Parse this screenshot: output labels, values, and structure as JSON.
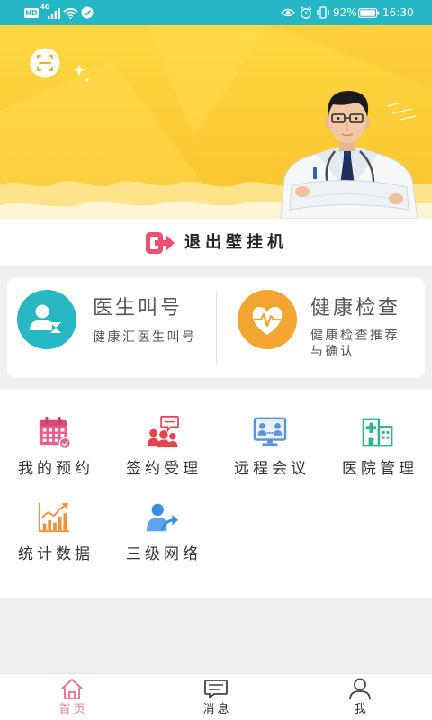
{
  "status_bar": {
    "hd": "HD",
    "network": "4G",
    "battery": "92%",
    "time": "16:30",
    "icons": [
      "signal-icon",
      "wifi-icon",
      "notification-icon",
      "eye-icon",
      "alarm-icon",
      "vibrate-icon",
      "battery-icon"
    ]
  },
  "banner": {
    "scan_icon": "scan-icon",
    "illustration": "doctor-illustration"
  },
  "exit": {
    "label": "退出壁挂机",
    "icon": "exit-icon"
  },
  "features": [
    {
      "title": "医生叫号",
      "subtitle": "健康汇医生叫号",
      "icon": "doctor-call-icon"
    },
    {
      "title": "健康检查",
      "subtitle": "健康检查推荐与确认",
      "icon": "health-check-heart-icon"
    }
  ],
  "grid": [
    {
      "label": "我的预约",
      "icon": "calendar-icon"
    },
    {
      "label": "签约受理",
      "icon": "contract-group-icon"
    },
    {
      "label": "远程会议",
      "icon": "video-meeting-icon"
    },
    {
      "label": "医院管理",
      "icon": "hospital-icon"
    },
    {
      "label": "统计数据",
      "icon": "statistics-chart-icon"
    },
    {
      "label": "三级网络",
      "icon": "network-referral-icon"
    }
  ],
  "tabs": [
    {
      "label": "首页",
      "icon": "home-icon",
      "active": true
    },
    {
      "label": "消息",
      "icon": "message-icon",
      "active": false
    },
    {
      "label": "我",
      "icon": "profile-icon",
      "active": false
    }
  ],
  "colors": {
    "status_bar": "#26b7c6",
    "banner": "#fcce3a",
    "teal": "#27b8c3",
    "orange": "#f3a531",
    "exit": "#ec4f72",
    "tab_active": "#ea7b9c",
    "text": "#333333"
  }
}
